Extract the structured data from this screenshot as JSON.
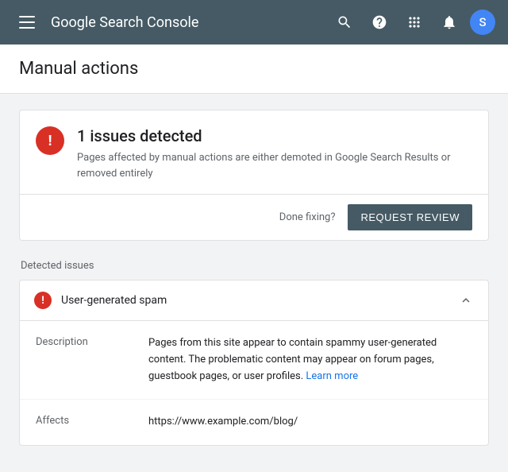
{
  "topnav": {
    "title": "Google Search Console",
    "avatar_letter": "S",
    "menu_label": "Main menu"
  },
  "page": {
    "title": "Manual actions"
  },
  "issues_card": {
    "count_label": "1 issues detected",
    "description": "Pages affected by manual actions are either demoted in Google Search Results or removed entirely",
    "done_fixing_label": "Done fixing?",
    "request_review_label": "REQUEST REVIEW"
  },
  "detected_issues": {
    "section_label": "Detected issues",
    "items": [
      {
        "name": "User-generated spam",
        "description_label": "Description",
        "description_text": "Pages from this site appear to contain spammy user-generated content. The problematic content may appear on forum pages, guestbook pages, or user profiles.",
        "learn_more_label": "Learn more",
        "affects_label": "Affects",
        "affects_url": "https://www.example.com/blog/"
      }
    ]
  },
  "icons": {
    "exclamation": "!",
    "search": "🔍",
    "help": "?",
    "grid": "⠿",
    "bell": "🔔",
    "chevron_up": "∧"
  }
}
